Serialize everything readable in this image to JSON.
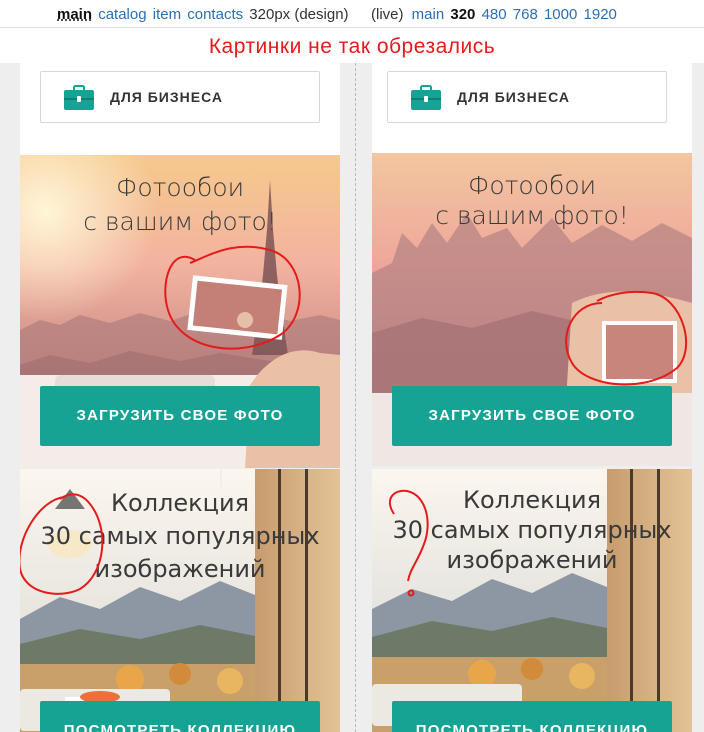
{
  "topbar": {
    "left": [
      {
        "label": "main",
        "style": "current"
      },
      {
        "label": "catalog",
        "style": "link"
      },
      {
        "label": "item",
        "style": "link"
      },
      {
        "label": "contacts",
        "style": "link"
      },
      {
        "label": "320px (design)",
        "style": "plain"
      }
    ],
    "right": [
      {
        "label": "(live)",
        "style": "plain"
      },
      {
        "label": "main",
        "style": "link"
      },
      {
        "label": "320",
        "style": "bold"
      },
      {
        "label": "480",
        "style": "link"
      },
      {
        "label": "768",
        "style": "link"
      },
      {
        "label": "1000",
        "style": "link"
      },
      {
        "label": "1920",
        "style": "link"
      }
    ]
  },
  "annotation": {
    "text": "Картинки не так обрезались",
    "color": "#e51a1a"
  },
  "colors": {
    "accent": "#16a394",
    "annotation": "#e51a1a",
    "link": "#2a6fb5"
  },
  "panels": [
    {
      "biz": {
        "label": "ДЛЯ БИЗНЕСА",
        "icon": "briefcase-icon"
      },
      "promo": {
        "title_line1": "Фотообои",
        "title_line2": "с вашим фото!",
        "cta": "ЗАГРУЗИТЬ СВОЕ ФОТО"
      },
      "collection": {
        "line1": "Коллекция",
        "line2": "30 самых популярных",
        "line3": "изображений",
        "cta": "ПОСМОТРЕТЬ КОЛЛЕКЦИЮ"
      }
    },
    {
      "biz": {
        "label": "ДЛЯ БИЗНЕСА",
        "icon": "briefcase-icon"
      },
      "promo": {
        "title_line1": "Фотообои",
        "title_line2": "с вашим фото!",
        "cta": "ЗАГРУЗИТЬ СВОЕ ФОТО"
      },
      "collection": {
        "line1": "Коллекция",
        "line2": "30 самых популярных",
        "line3": "изображений",
        "cta": "ПОСМОТРЕТЬ КОЛЛЕКЦИЮ"
      }
    }
  ]
}
